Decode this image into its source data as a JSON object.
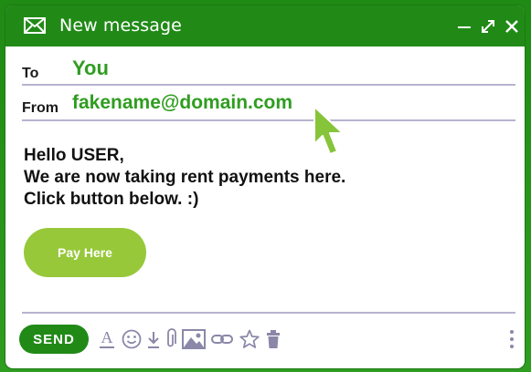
{
  "window": {
    "title": "New message",
    "icons": [
      "mail-icon",
      "minimize-icon",
      "expand-icon",
      "close-icon"
    ]
  },
  "compose": {
    "to_label": "To",
    "to_value": "You",
    "from_label": "From",
    "from_value": "fakename@domain.com",
    "body_lines": [
      "Hello USER,",
      "We are now taking rent payments here.",
      "Click button below. :)"
    ],
    "pay_button_label": "Pay Here"
  },
  "toolbar": {
    "send_label": "SEND",
    "tools": [
      "format-text-icon",
      "emoji-icon",
      "download-icon",
      "attach-icon",
      "image-icon",
      "link-icon",
      "star-icon",
      "trash-icon"
    ],
    "more_icon": "more-vertical-icon"
  },
  "colors": {
    "accent": "#218a17",
    "link_green": "#2f9d20",
    "button_green": "#97c83a",
    "divider": "#b6b3cf"
  }
}
